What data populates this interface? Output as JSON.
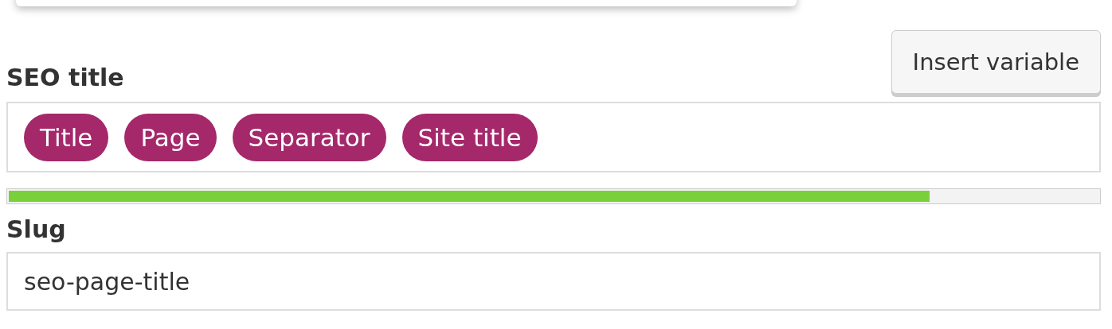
{
  "seo_title": {
    "label": "SEO title",
    "button": "Insert variable",
    "variables": [
      {
        "label": "Title"
      },
      {
        "label": "Page"
      },
      {
        "label": "Separator"
      },
      {
        "label": "Site title"
      }
    ],
    "progress": {
      "level": 0.845
    }
  },
  "slug": {
    "label": "Slug",
    "value": "seo-page-title"
  }
}
